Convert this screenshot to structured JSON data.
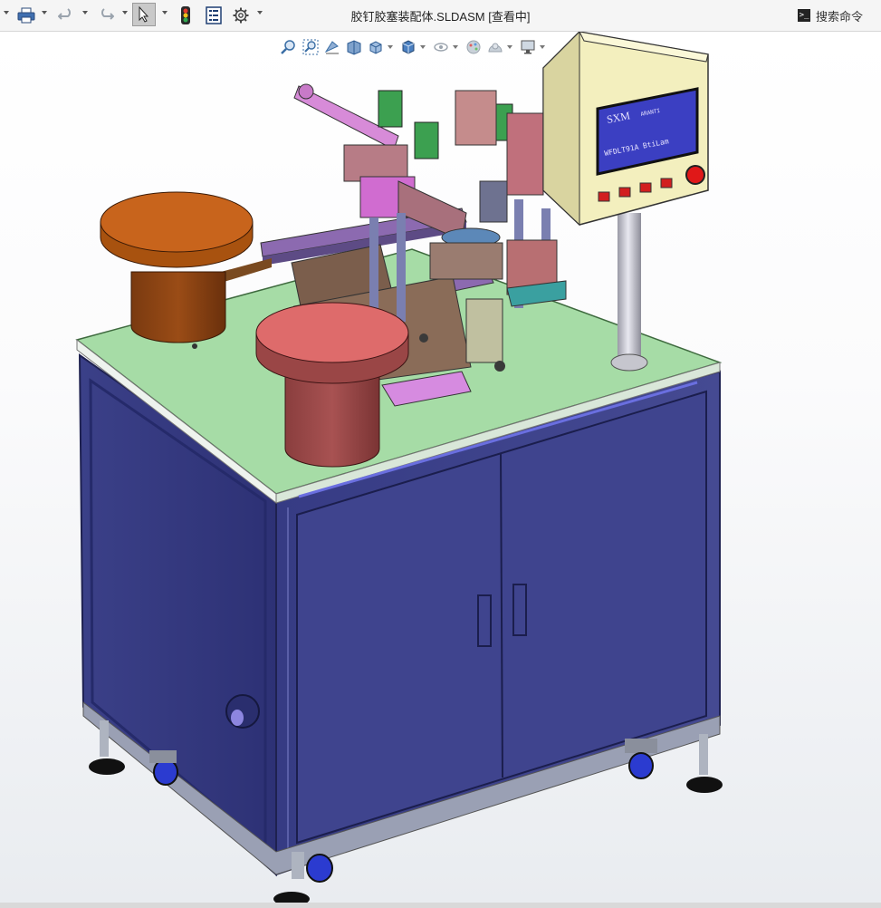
{
  "titlebar": {
    "document_title": "胶钉胶塞装配体.SLDASM [查看中]",
    "search_label": "搜索命令",
    "search_icon_glyph": ">_"
  },
  "toolbar": {
    "buttons": [
      {
        "name": "print",
        "icon": "printer-icon"
      },
      {
        "name": "undo",
        "icon": "undo-icon"
      },
      {
        "name": "redo",
        "icon": "redo-icon"
      },
      {
        "name": "select",
        "icon": "cursor-icon"
      },
      {
        "name": "rebuild",
        "icon": "traffic-light-icon"
      },
      {
        "name": "file-properties",
        "icon": "file-properties-icon"
      },
      {
        "name": "options",
        "icon": "gear-icon"
      }
    ]
  },
  "heads_up_toolbar": {
    "buttons": [
      "zoom-to-fit-icon",
      "zoom-to-area-icon",
      "previous-view-icon",
      "section-view-icon",
      "view-orientation-icon",
      "display-style-icon",
      "hide-show-items-icon",
      "edit-appearance-icon",
      "apply-scene-icon",
      "view-settings-icon"
    ]
  },
  "model": {
    "hmi_panel": {
      "brand": "SXM",
      "line1": "ARANTI",
      "line2": "WFDLT91A BtiLam"
    },
    "colors": {
      "cabinet": "#3a3f86",
      "tabletop": "#a6dca6",
      "bowl_orange": "#c8641c",
      "bowl_red": "#d06060",
      "control_box": "#f3efbe",
      "screen": "#3b3fc2"
    }
  }
}
